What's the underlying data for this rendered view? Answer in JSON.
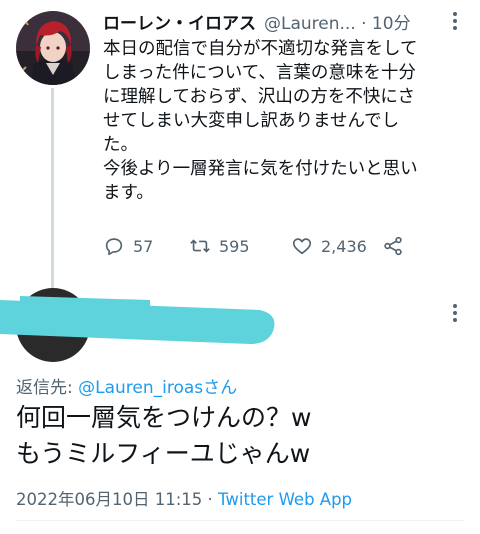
{
  "tweet1": {
    "author_name": "ローレン・イロアス",
    "handle_time": "@Lauren... · 10分",
    "body_lines": [
      "本日の配信で自分が不適切な発言をして",
      "しまった件について、言葉の意味を十分",
      "に理解しておらず、沢山の方を不快にさ",
      "せてしまい大変申し訳ありませんでし",
      "た。",
      "今後より一層発言に気を付けたいと思い",
      "ます。"
    ],
    "actions": {
      "reply_count": "57",
      "retweet_count": "595",
      "like_count": "2,436"
    }
  },
  "tweet2": {
    "reply_prefix": "返信先: ",
    "reply_handle": "@Lauren_iroas",
    "reply_suffix": "さん",
    "body_lines": [
      "何回一層気をつけんの？w",
      "もうミルフィーユじゃんw"
    ],
    "timestamp": "2022年06月10日 11:15",
    "separator": " · ",
    "source": "Twitter Web App"
  },
  "colors": {
    "text": "#0f1419",
    "secondary": "#536471",
    "link": "#1d9bf0",
    "redaction": "#5fd3dc"
  }
}
